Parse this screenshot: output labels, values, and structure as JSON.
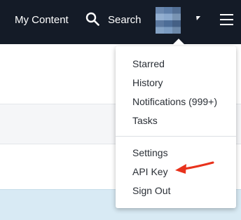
{
  "nav": {
    "my_content": "My Content",
    "search": "Search",
    "search_icon": "search-icon",
    "avatar": "user-avatar",
    "menu_icon": "hamburger-menu-icon"
  },
  "menu": {
    "group1": [
      "Starred",
      "History",
      "Notifications (999+)",
      "Tasks"
    ],
    "group2": [
      "Settings",
      "API Key",
      "Sign Out"
    ]
  },
  "colors": {
    "topbar": "#141b27",
    "annotation_arrow": "#e8321c",
    "content_highlight": "#d8eaf4"
  }
}
